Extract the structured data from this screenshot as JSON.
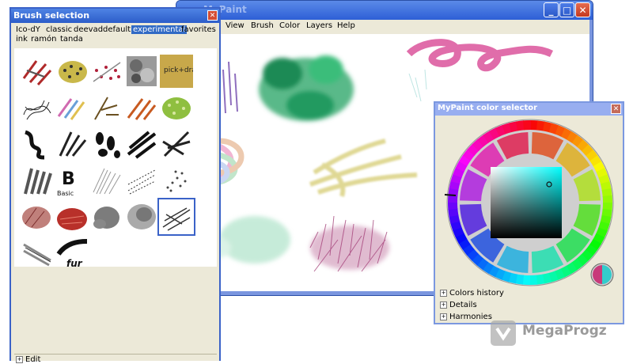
{
  "main_window": {
    "title": "MyPaint",
    "menu": [
      "View",
      "Brush",
      "Color",
      "Layers",
      "Help"
    ],
    "buttons": {
      "minimize": "_",
      "maximize": "□",
      "close": "✕"
    }
  },
  "brush_window": {
    "title": "Brush selection",
    "close_label": "✕",
    "tabs": [
      {
        "label": "Ico-dY",
        "active": false
      },
      {
        "label": "classic",
        "active": false
      },
      {
        "label": "deevad",
        "active": false
      },
      {
        "label": "default",
        "active": false
      },
      {
        "label": "experimental",
        "active": true
      },
      {
        "label": "favorites",
        "active": false
      },
      {
        "label": "ink",
        "active": false
      },
      {
        "label": "ramón",
        "active": false
      },
      {
        "label": "tanda",
        "active": false
      }
    ],
    "tile_labels": {
      "basic": "Basic",
      "fur": "fur",
      "pick_drag": "pick+drag color"
    },
    "edit_label": "Edit",
    "expander_symbol": "+"
  },
  "color_window": {
    "title": "MyPaint color selector",
    "close_label": "✕",
    "expanders": [
      "Colors history",
      "Details",
      "Harmonies"
    ],
    "expander_symbol": "+",
    "selected_color": "#33cccc"
  },
  "watermark": {
    "text": "MegaProgz"
  }
}
